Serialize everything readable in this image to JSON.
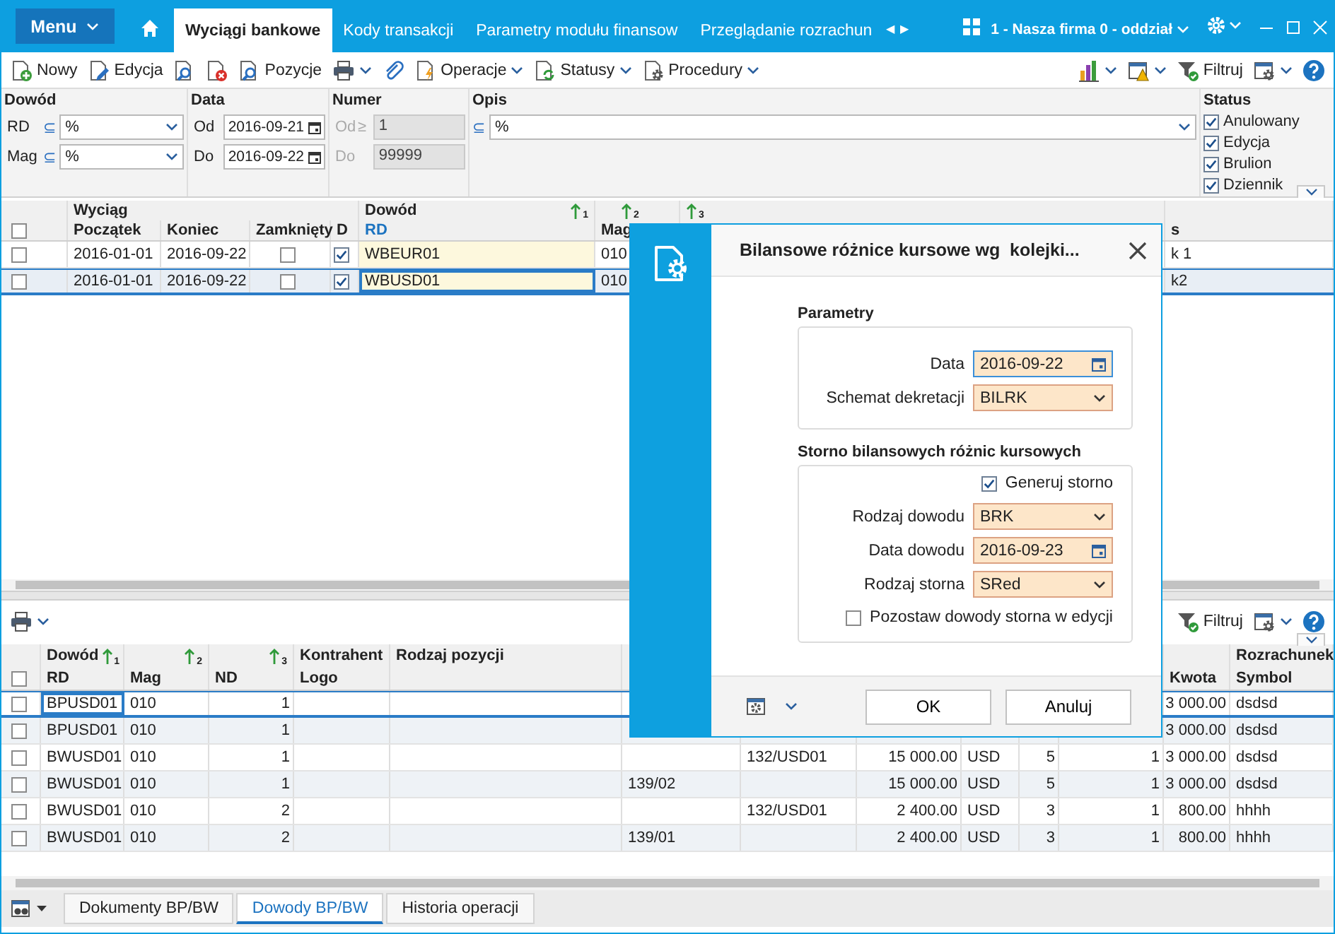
{
  "menu_button": {
    "label": "Menu"
  },
  "tabs": [
    {
      "label": "Wyciągi bankowe",
      "selected": true
    },
    {
      "label": "Kody transakcji",
      "selected": false
    },
    {
      "label": "Parametry modułu finansow",
      "selected": false
    },
    {
      "label": "Przeglądanie rozrachun",
      "selected": false
    }
  ],
  "tab_arrows": [
    "◀",
    "▶"
  ],
  "company": "1 - Nasza firma 0 - oddział",
  "toolbar": {
    "left": [
      {
        "kind": "new",
        "label": "Nowy"
      },
      {
        "kind": "edit",
        "label": "Edycja"
      },
      {
        "kind": "find"
      },
      {
        "kind": "delete"
      },
      {
        "kind": "positions",
        "label": "Pozycje"
      },
      {
        "kind": "print",
        "menu": true
      },
      {
        "kind": "attach"
      },
      {
        "kind": "operations",
        "label": "Operacje",
        "menu": true
      },
      {
        "kind": "statuses",
        "label": "Statusy",
        "menu": true
      },
      {
        "kind": "procedures",
        "label": "Procedury",
        "menu": true
      }
    ],
    "right": [
      {
        "kind": "chart",
        "menu": true
      },
      {
        "kind": "warning",
        "menu": true
      },
      {
        "kind": "filter",
        "label": "Filtruj"
      },
      {
        "kind": "columns",
        "menu": true
      },
      {
        "kind": "help"
      }
    ]
  },
  "filters": {
    "dowod": {
      "heading": "Dowód",
      "rows": [
        {
          "label": "RD",
          "op": "⊆",
          "value": "%"
        },
        {
          "label": "Mag",
          "op": "⊆",
          "value": "%"
        }
      ]
    },
    "data": {
      "heading": "Data",
      "rows": [
        {
          "label": "Od",
          "value": "2016-09-21"
        },
        {
          "label": "Do",
          "value": "2016-09-22"
        }
      ]
    },
    "numer": {
      "heading": "Numer",
      "disabled": true,
      "rows": [
        {
          "label": "Od",
          "op": "≥",
          "value": "1"
        },
        {
          "label": "Do",
          "value": "99999"
        }
      ]
    },
    "opis": {
      "heading": "Opis",
      "op": "⊆",
      "value": "%"
    },
    "status": {
      "heading": "Status",
      "items": [
        {
          "label": "Anulowany",
          "checked": true
        },
        {
          "label": "Edycja",
          "checked": true
        },
        {
          "label": "Brulion",
          "checked": true
        },
        {
          "label": "Dziennik",
          "checked": true
        }
      ]
    }
  },
  "upper_grid": {
    "group_headers": [
      "Wyciąg",
      "Dowód"
    ],
    "sort_marks": [
      "1",
      "2",
      "3"
    ],
    "header_checked": false,
    "columns": [
      {
        "label": "Początek",
        "sorted": false
      },
      {
        "label": "Koniec",
        "sorted": false
      },
      {
        "label": "Zamknięty",
        "sorted": false
      },
      {
        "label": "D",
        "sorted": false
      },
      {
        "label": "RD",
        "sorted": true
      },
      {
        "label": "Mag",
        "sorted": false
      },
      {
        "label": "s",
        "sorted": false
      }
    ],
    "rows": [
      {
        "selected": false,
        "checked": false,
        "start": "2016-01-01",
        "end": "2016-09-22",
        "closed": false,
        "d": true,
        "rd": "WBEUR01",
        "mag": "010",
        "column_7": "k 1"
      },
      {
        "selected": true,
        "checked": false,
        "start": "2016-01-01",
        "end": "2016-09-22",
        "closed": false,
        "d": true,
        "rd": "WBUSD01",
        "mag": "010",
        "column_7": "k2"
      }
    ]
  },
  "lower_toolbar": {
    "left": [
      {
        "kind": "print",
        "menu": true
      }
    ],
    "right": [
      {
        "kind": "filter",
        "label": "Filtruj"
      },
      {
        "kind": "columns",
        "menu": true
      },
      {
        "kind": "help"
      }
    ]
  },
  "lower_grid": {
    "group_headers": [
      "Dowód",
      "Kontrahent",
      "Rodzaj pozycji",
      "Rozrachunek"
    ],
    "sort_marks": [
      "1",
      "2",
      "3"
    ],
    "header_checked": false,
    "columns": [
      {
        "label": "RD",
        "sorted": false
      },
      {
        "label": "Mag",
        "sorted": false
      },
      {
        "label": "ND",
        "sorted": false
      },
      {
        "label": "Logo",
        "sorted": false
      },
      {
        "label": "Kwota",
        "sorted": false
      },
      {
        "label": "Symbol",
        "sorted": false
      }
    ],
    "rows": [
      {
        "selected": true,
        "checked": false,
        "rd": "BPUSD01",
        "mag": "010",
        "nd": "1",
        "kwota": "3 000.00",
        "symbol": "dsdsd"
      },
      {
        "selected": false,
        "checked": false,
        "rd": "BPUSD01",
        "mag": "010",
        "nd": "1",
        "kwota": "3 000.00",
        "symbol": "dsdsd"
      },
      {
        "selected": false,
        "checked": false,
        "rd": "BWUSD01",
        "mag": "010",
        "nd": "1",
        "column_7": "132/USD01",
        "column_8": "15 000.00",
        "column_9": "USD",
        "column_10": "5",
        "column_11": "1",
        "kwota": "3 000.00",
        "symbol": "dsdsd"
      },
      {
        "selected": false,
        "checked": false,
        "rd": "BWUSD01",
        "mag": "010",
        "nd": "1",
        "column_6": "139/02",
        "column_8": "15 000.00",
        "column_9": "USD",
        "column_10": "5",
        "column_11": "1",
        "kwota": "3 000.00",
        "symbol": "dsdsd"
      },
      {
        "selected": false,
        "checked": false,
        "rd": "BWUSD01",
        "mag": "010",
        "nd": "2",
        "column_7": "132/USD01",
        "column_8": "2 400.00",
        "column_9": "USD",
        "column_10": "3",
        "column_11": "1",
        "kwota": "800.00",
        "symbol": "hhhh"
      },
      {
        "selected": false,
        "checked": false,
        "rd": "BWUSD01",
        "mag": "010",
        "nd": "2",
        "column_6": "139/01",
        "column_8": "2 400.00",
        "column_9": "USD",
        "column_10": "3",
        "column_11": "1",
        "kwota": "800.00",
        "symbol": "hhhh"
      }
    ]
  },
  "bottom_tabs": [
    {
      "label": "Dokumenty BP/BW",
      "selected": false
    },
    {
      "label": "Dowody BP/BW",
      "selected": true
    },
    {
      "label": "Historia operacji",
      "selected": false
    }
  ],
  "dialog": {
    "title": "Bilansowe różnice kursowe wg  kolejki...",
    "sections": [
      {
        "heading": "Parametry",
        "fields": [
          {
            "kind": "date",
            "label": "Data",
            "value": "2016-09-22",
            "focused": true
          },
          {
            "kind": "select",
            "label": "Schemat dekretacji",
            "value": "BILRK",
            "focused": false
          }
        ]
      },
      {
        "heading": "Storno bilansowych różnic kursowych",
        "fields": [
          {
            "kind": "check",
            "label": "Generuj storno",
            "checked": true
          },
          {
            "kind": "select",
            "label": "Rodzaj dowodu",
            "value": "BRK",
            "focused": false
          },
          {
            "kind": "date",
            "label": "Data dowodu",
            "value": "2016-09-23",
            "focused": false
          },
          {
            "kind": "select",
            "label": "Rodzaj storna",
            "value": "SRed",
            "focused": false
          },
          {
            "kind": "check",
            "label": "Pozostaw dowody storna w edycji",
            "checked": false
          }
        ]
      }
    ],
    "buttons": [
      "OK",
      "Anuluj"
    ]
  }
}
